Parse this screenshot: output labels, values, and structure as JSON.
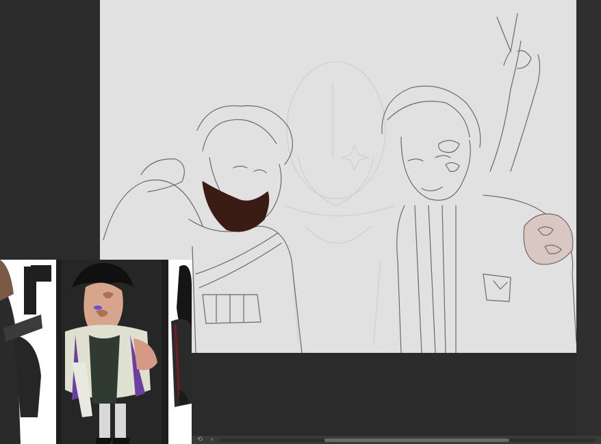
{
  "app": {
    "document": "sketch-of-two-characters-with-faded-third",
    "canvas_background": "#e2e1e1",
    "workspace_background": "#2b2b2b"
  },
  "reference_panel": {
    "description_icon": "reference-image",
    "images": [
      "left-character-crop",
      "center-character-reference",
      "right-character-crop"
    ]
  },
  "statusbar": {
    "rotate_icon": "rotate-icon",
    "prev_icon": "chevron-left-icon",
    "rotate_glyph": "⟲",
    "prev_glyph": "‹",
    "scroll_fraction": 0.49
  }
}
